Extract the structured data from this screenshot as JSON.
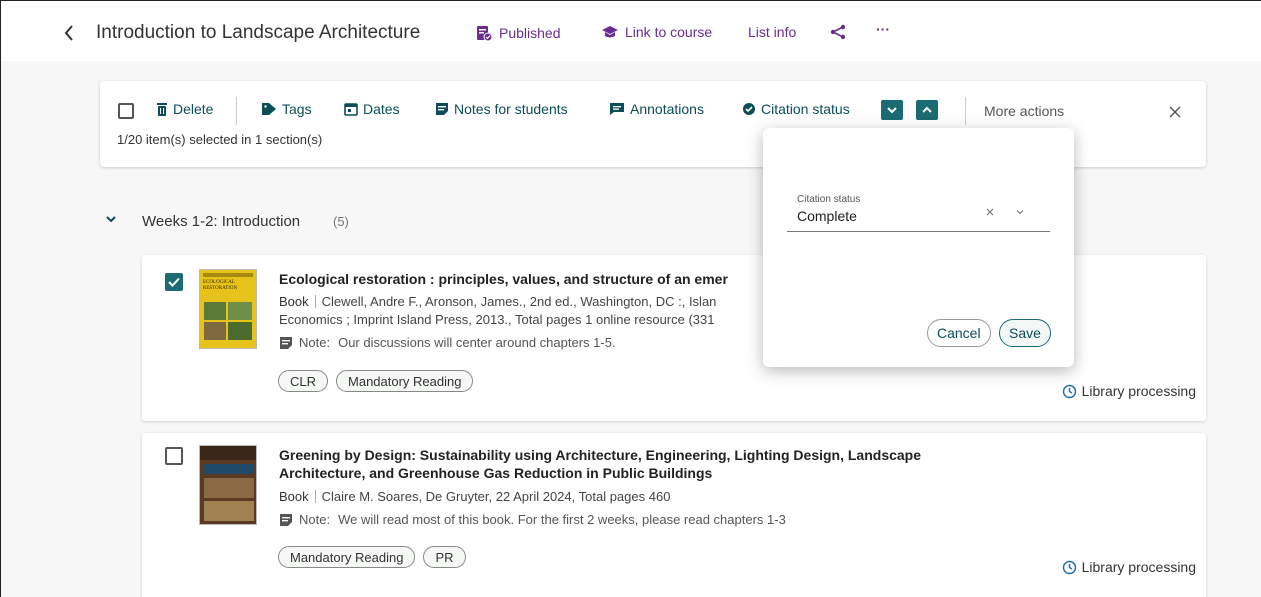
{
  "header": {
    "title": "Introduction to Landscape Architecture",
    "published_label": "Published",
    "link_label": "Link to course",
    "list_info_label": "List info",
    "more_label": "···"
  },
  "bulk_bar": {
    "delete_label": "Delete",
    "tags_label": "Tags",
    "dates_label": "Dates",
    "notes_label": "Notes for students",
    "annotations_label": "Annotations",
    "citation_status_label": "Citation status",
    "more_actions_label": "More actions",
    "selection_text": "1/20 item(s) selected in 1 section(s)"
  },
  "section": {
    "title": "Weeks 1-2: Introduction",
    "count": "(5)"
  },
  "items": [
    {
      "checked": true,
      "title": "Ecological restoration : principles, values, and structure of an emer",
      "type": "Book",
      "meta_line1": "Clewell, Andre F., Aronson, James., 2nd ed., Washington, DC :, Islan",
      "meta_line2": "Economics ; Imprint Island Press, 2013., Total pages 1 online resource (331",
      "note_label": "Note:",
      "note": "Our discussions will center around chapters 1-5.",
      "tags": [
        "CLR",
        "Mandatory Reading"
      ],
      "status": "Library processing",
      "cover_text_1": "ECOLOGICAL",
      "cover_text_2": "RESTORATION"
    },
    {
      "checked": false,
      "title_line1": "Greening by Design: Sustainability using Architecture, Engineering, Lighting Design, Landscape",
      "title_line2": "Architecture, and Greenhouse Gas Reduction in Public Buildings",
      "type": "Book",
      "meta_line1": "Claire M. Soares, De Gruyter, 22 April 2024, Total pages 460",
      "note_label": "Note:",
      "note": "We will read most of this book. For the first 2 weeks, please read chapters 1-3",
      "tags": [
        "Mandatory Reading",
        "PR"
      ],
      "status": "Library processing"
    }
  ],
  "popover": {
    "field_label": "Citation status",
    "field_value": "Complete",
    "cancel_label": "Cancel",
    "save_label": "Save"
  },
  "colors": {
    "accent_purple": "#6a2c91",
    "accent_teal": "#1a6b72",
    "status_blue": "#2a6fb0"
  }
}
